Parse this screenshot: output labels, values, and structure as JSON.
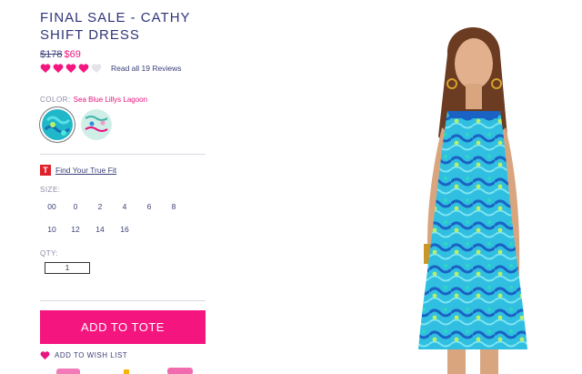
{
  "product": {
    "title": "FINAL SALE - CATHY SHIFT DRESS",
    "price_was": "$178",
    "price_now": "$69",
    "rating": 4,
    "rating_max": 5,
    "reviews_link": "Read all 19 Reviews"
  },
  "color": {
    "label": "COLOR:",
    "selected": "Sea Blue Lillys Lagoon",
    "swatches": [
      "swatch-sea-blue",
      "swatch-light-print"
    ]
  },
  "fit": {
    "link": "Find Your True Fit",
    "icon_letter": "T"
  },
  "size": {
    "label": "SIZE:",
    "options": [
      "00",
      "0",
      "2",
      "4",
      "6",
      "8",
      "10",
      "12",
      "14",
      "16"
    ]
  },
  "qty": {
    "label": "QTY:",
    "value": "1"
  },
  "actions": {
    "add_to_tote": "ADD TO TOTE",
    "wish_list": "ADD TO WISH LIST"
  },
  "colors": {
    "accent": "#f5157f",
    "navy": "#2f3478",
    "dress": "#2ec4e0"
  }
}
